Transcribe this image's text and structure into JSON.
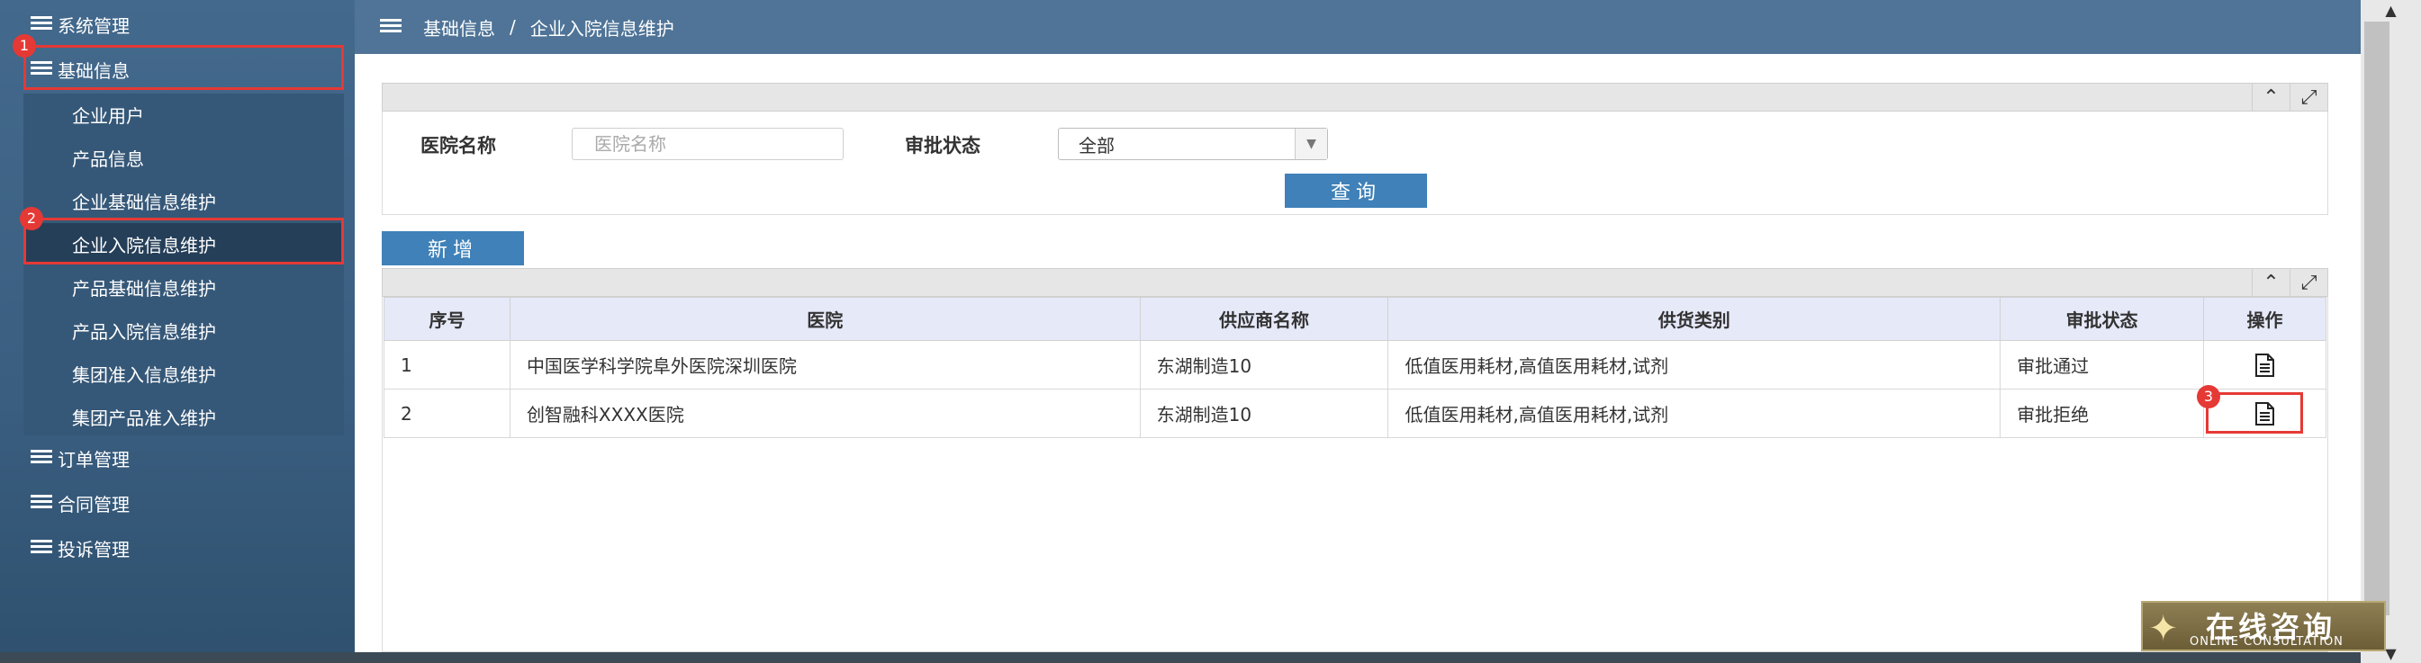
{
  "sidebar": {
    "top_items": [
      {
        "label": "系统管理"
      },
      {
        "label": "基础信息"
      },
      {
        "label": "订单管理"
      },
      {
        "label": "合同管理"
      },
      {
        "label": "投诉管理"
      }
    ],
    "sub_items": [
      {
        "label": "企业用户"
      },
      {
        "label": "产品信息"
      },
      {
        "label": "企业基础信息维护"
      },
      {
        "label": "企业入院信息维护"
      },
      {
        "label": "产品基础信息维护"
      },
      {
        "label": "产品入院信息维护"
      },
      {
        "label": "集团准入信息维护"
      },
      {
        "label": "集团产品准入维护"
      }
    ],
    "badges": [
      "1",
      "2"
    ]
  },
  "breadcrumb": {
    "root": "基础信息",
    "separator": "/",
    "current": "企业入院信息维护"
  },
  "search": {
    "hospital_label": "医院名称",
    "hospital_placeholder": "医院名称",
    "status_label": "审批状态",
    "status_value": "全部",
    "query_button": "查询"
  },
  "toolbar": {
    "add_button": "新增"
  },
  "table": {
    "columns": [
      "序号",
      "医院",
      "供应商名称",
      "供货类别",
      "审批状态",
      "操作"
    ],
    "rows": [
      {
        "index": "1",
        "hospital": "中国医学科学院阜外医院深圳医院",
        "supplier": "东湖制造10",
        "category": "低值医用耗材,高值医用耗材,试剂",
        "status": "审批通过"
      },
      {
        "index": "2",
        "hospital": "创智融科XXXX医院",
        "supplier": "东湖制造10",
        "category": "低值医用耗材,高值医用耗材,试剂",
        "status": "审批拒绝"
      }
    ],
    "badge": "3"
  },
  "consult": {
    "title": "在线咨询",
    "subtitle": "ONLINE CONSULTATION"
  },
  "icons": {
    "collapse": "chevron-up-icon",
    "expand": "expand-icon",
    "menu": "hamburger-icon",
    "action": "document-icon"
  },
  "colors": {
    "sidebar": "#43698c",
    "topbar": "#4f7497",
    "button": "#3f81b8",
    "highlight": "#e53935"
  }
}
